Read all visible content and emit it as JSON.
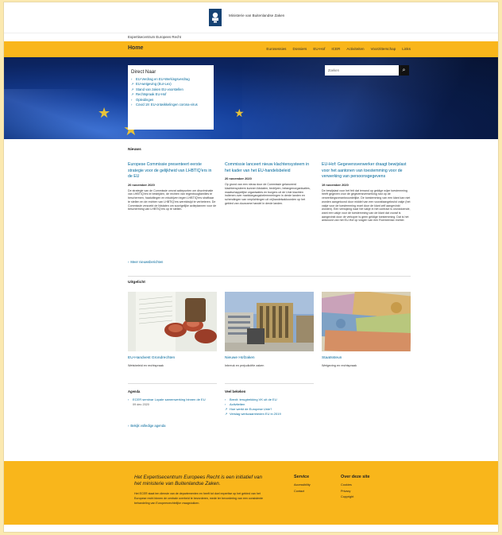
{
  "header": {
    "ministry": "Ministerie van Buitenlandse Zaken",
    "subtitle": "Expertisecentrum Europees Recht"
  },
  "nav": {
    "home": "Home",
    "items": [
      "Eurosessies",
      "Dossiers",
      "EU-Hof",
      "ICER",
      "Activiteiten",
      "Voorzitterschap",
      "Links"
    ]
  },
  "direct": {
    "title": "Direct Naar",
    "items": [
      {
        "label": "EU-Verdrag en EU-Werkingsverdrag",
        "icon": "chevron-right-icon"
      },
      {
        "label": "EU-wetgeving (Eur-Lex)",
        "icon": "external-link-icon"
      },
      {
        "label": "Stand van zaken EU-voorstellen",
        "icon": "external-link-icon"
      },
      {
        "label": "Rechtspraak EU-Hof",
        "icon": "external-link-icon"
      },
      {
        "label": "Opleidingen",
        "icon": "chevron-right-icon"
      },
      {
        "label": "Covid 19: EU-ontwikkelingen corona-virus",
        "icon": "chevron-right-icon"
      }
    ]
  },
  "search": {
    "placeholder": "Zoeken",
    "icon": "search-icon"
  },
  "news": {
    "title": "Nieuws",
    "items": [
      {
        "title": "Europese Commissie presenteert eerste strategie voor de gelijkheid van LHBTIQ'ers in de EU",
        "date": "20 november 2020",
        "text": "De strategie van de Commissie omvat actiepunten om discriminatie van LHBTIQ'ers te bestrijden, de rechten van regenboogfamilies te beschermen, haatuitingen en misdrijven tegen LHBTIQ'ers strafbaar te stellen en de rechten van LHBTIQ'ers wereldwijd te verbeteren. De Commissie verzoekt de lidstaten om soortgelijke actieplannen voor de bescherming van LHBTIQ'ers op te stellen."
      },
      {
        "title": "Commissie lanceert nieuw klachtensysteem in het kader van het EU-handelsbeleid",
        "date": "20 november 2020",
        "text": "Op grond van een nieuw door de Commissie gelanceerd klachtensysteem kunnen lidstaten, bedrijven, belangenorganisaties, maatschappelijke organisaties en burgers uit de Unie klachten indienen over marktoegangsbelemmeringen in derde landen en schendingen van verplichtingen uit vrijhandelsakkoorden op het gebied van duurzame handel in derde landen."
      },
      {
        "title": "EU-Hof: Gegevensverwerker draagt bewijslast voor het aantonen van toestemming voor de verwerking van persoonsgegevens",
        "date": "19 november 2020",
        "text": "De bewijslast voor het feit dat iemand op geldige wijze toestemming heeft gegeven voor de gegevensverwerking rust op de verwerkingsverantwoordelijke. De toestemming van een klant kan niet worden aangetoond door middel van een voorafaangekruist vakje (het vakje voor de toestemming moet door de klant zelf aangevinkt worden). Een verwijzing naar het vakje in het contract is onvoldoende, want een vakje voor de toestemming van de klant dat vooraf is aangevinkt door de verkoper is geen geldige toestemming. Dat is het antwoord van het EU-Hof op vragen van een Roemeense rechter."
      }
    ],
    "more": "Meer nieuwsberichten"
  },
  "uitgelicht": {
    "title": "Uitgelicht",
    "cards": [
      {
        "title": "EU-Handvest Grondrechten",
        "desc": "Wetsbeleid en rechtspraak",
        "image": "documents-stamp-photo"
      },
      {
        "title": "Nieuwe Hofzaken",
        "desc": "Inbreuk en prejudiciële zaken",
        "image": "eu-court-building-photo"
      },
      {
        "title": "Staatssteun",
        "desc": "Wetgeving en rechtspraak",
        "image": "euro-banknotes-photo"
      }
    ]
  },
  "agenda": {
    "title": "Agenda",
    "items": [
      {
        "label": "ECER seminar Loyale samenwerking binnen de EU",
        "date": "09 dec 2020"
      }
    ],
    "more": "Bekijk volledige agenda"
  },
  "veel_bekeken": {
    "title": "Veel bekeken",
    "items": [
      {
        "label": "Brexit: terugtrekking VK uit de EU",
        "icon": "chevron-right-icon"
      },
      {
        "label": "Activiteiten",
        "icon": "chevron-right-icon"
      },
      {
        "label": "Hoe werkt de Europese Unie?",
        "icon": "external-link-icon"
      },
      {
        "label": "Verslag werkzaamheden EU in 2019",
        "icon": "external-link-icon"
      }
    ]
  },
  "footer": {
    "tagline": "Het Expertisecentrum Europees Recht is een initiatief van het ministerie van Buitenlandse Zaken.",
    "text": "Het ECER staat ten dienste van de departementen en heeft tot doel expertise op het gebied van het Europese recht binnen de centrale overheid te bevorderen, mede ter bevordering van een consistente behandeling van Europeesrechtelijke vraagstukken.",
    "service": {
      "title": "Service",
      "items": [
        "Accessibility",
        "Contact"
      ]
    },
    "about": {
      "title": "Over deze site",
      "items": [
        "Cookies",
        "Privacy",
        "Copyright"
      ]
    }
  },
  "colors": {
    "accent": "#f9b61b",
    "link": "#01689b",
    "brand": "#154273"
  }
}
